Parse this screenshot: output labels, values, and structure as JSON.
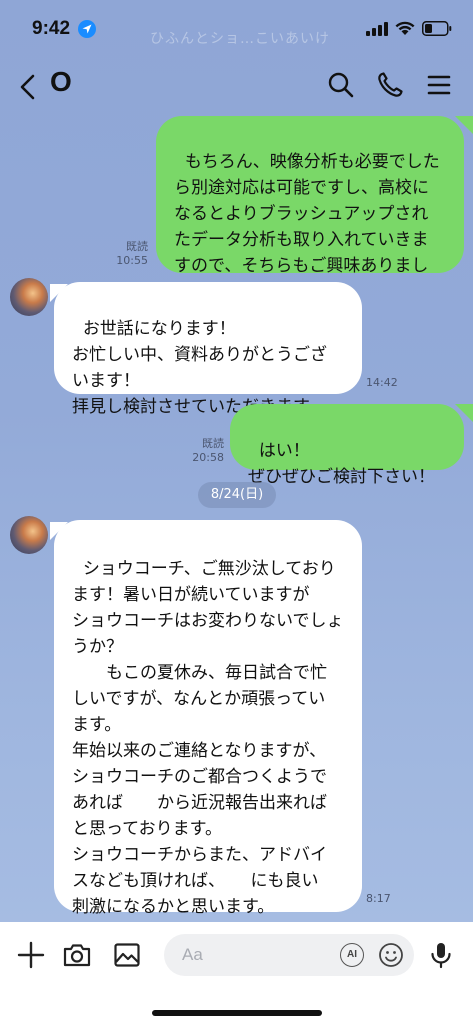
{
  "status_bar": {
    "time": "9:42",
    "icons": [
      "location-arrow-icon",
      "signal-bars-icon",
      "wifi-icon",
      "battery-icon"
    ],
    "faded_banner": "ひふんとショ…こいあいけ"
  },
  "header": {
    "back_icon": "chevron-left-icon",
    "title": "O",
    "actions": [
      "search-icon",
      "phone-icon",
      "menu-icon"
    ]
  },
  "messages": [
    {
      "id": "m1",
      "direction": "sent",
      "text": "もちろん、映像分析も必要でした\nら別途対応は可能ですし、高校に\nなるとよりブラッシュアップされ\nたデータ分析も取り入れていきま\nすので、そちらもご興味ありまし\nたらぜひ！！",
      "read": "既読",
      "time": "10:55"
    },
    {
      "id": "m2",
      "direction": "received",
      "text": "お世話になります！\nお忙しい中、資料ありがとうござ\nいます！\n拝見し検討させていただきます。",
      "time": "14:42"
    },
    {
      "id": "m3",
      "direction": "sent",
      "text": "はい！\nぜひぜひご検討下さい！",
      "read": "既読",
      "time": "20:58"
    },
    {
      "id": "m4",
      "direction": "received",
      "text": "ショウコーチ、ご無沙汰しており\nます！暑い日が続いていますが\nショウコーチはお変わりないでしょ\nうか？\n　　もこの夏休み、毎日試合で忙\nしいですが、なんとか頑張ってい\nます。\n年始以来のご連絡となりますが、\nショウコーチのご都合つくようで\nあれば　　から近況報告出来れば\nと思っております。\nショウコーチからまた、アドバイ\nスなども頂ければ、　　にも良い\n刺激になるかと思います。\nお忙しいとは思いますが、ご検討\nよろしくお願いいたします",
      "emoji": "🙇‍♀️",
      "time": "8:17"
    }
  ],
  "date_separator": "8/24(日)",
  "composer": {
    "placeholder": "Aa",
    "ai_label": "AI",
    "icons": [
      "plus-icon",
      "camera-icon",
      "image-icon",
      "emoji-icon",
      "microphone-icon"
    ]
  },
  "colors": {
    "sent_bubble": "#7ad868",
    "received_bubble": "#ffffff",
    "background": "#93aad8"
  }
}
